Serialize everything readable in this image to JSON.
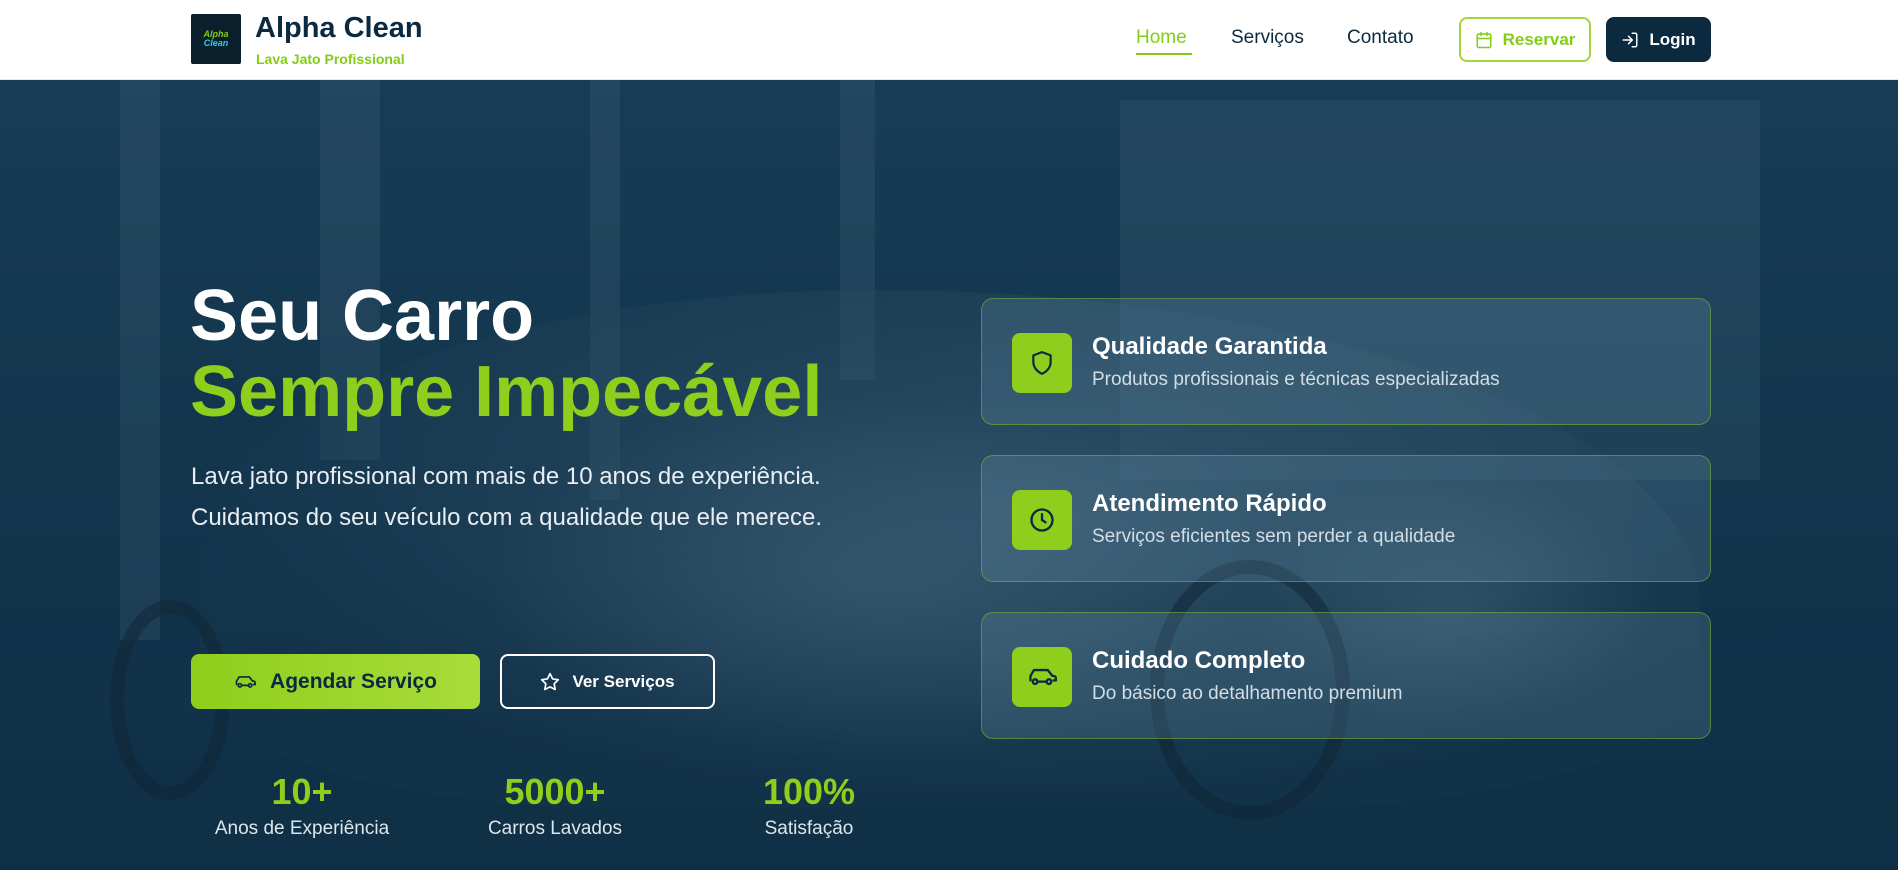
{
  "header": {
    "logo_line1": "Alpha",
    "logo_line2": "Clean",
    "brand_name": "Alpha Clean",
    "brand_tagline": "Lava Jato Profissional",
    "nav": [
      {
        "label": "Home",
        "active": true
      },
      {
        "label": "Serviços",
        "active": false
      },
      {
        "label": "Contato",
        "active": false
      }
    ],
    "reserve_label": "Reservar",
    "reserve_icon": "calendar-icon",
    "login_label": "Login",
    "login_icon": "login-icon"
  },
  "hero": {
    "headline_line1": "Seu Carro",
    "headline_line2": "Sempre Impecável",
    "subtext_line1": "Lava jato profissional com mais de 10 anos de experiência.",
    "subtext_line2": "Cuidamos do seu veículo com a qualidade que ele merece.",
    "primary_cta": {
      "label": "Agendar Serviço",
      "icon": "car-icon"
    },
    "secondary_cta": {
      "label": "Ver Serviços",
      "icon": "star-icon"
    },
    "stats": [
      {
        "value": "10+",
        "label": "Anos de Experiência"
      },
      {
        "value": "5000+",
        "label": "Carros Lavados"
      },
      {
        "value": "100%",
        "label": "Satisfação"
      }
    ],
    "features": [
      {
        "title": "Qualidade Garantida",
        "description": "Produtos profissionais e técnicas especializadas",
        "icon": "shield-icon"
      },
      {
        "title": "Atendimento Rápido",
        "description": "Serviços eficientes sem perder a qualidade",
        "icon": "clock-icon"
      },
      {
        "title": "Cuidado Completo",
        "description": "Do básico ao detalhamento premium",
        "icon": "car-icon"
      }
    ]
  },
  "colors": {
    "accent": "#8fce1c",
    "navy": "#0b2a3f",
    "hero_overlay": "#12324a"
  }
}
